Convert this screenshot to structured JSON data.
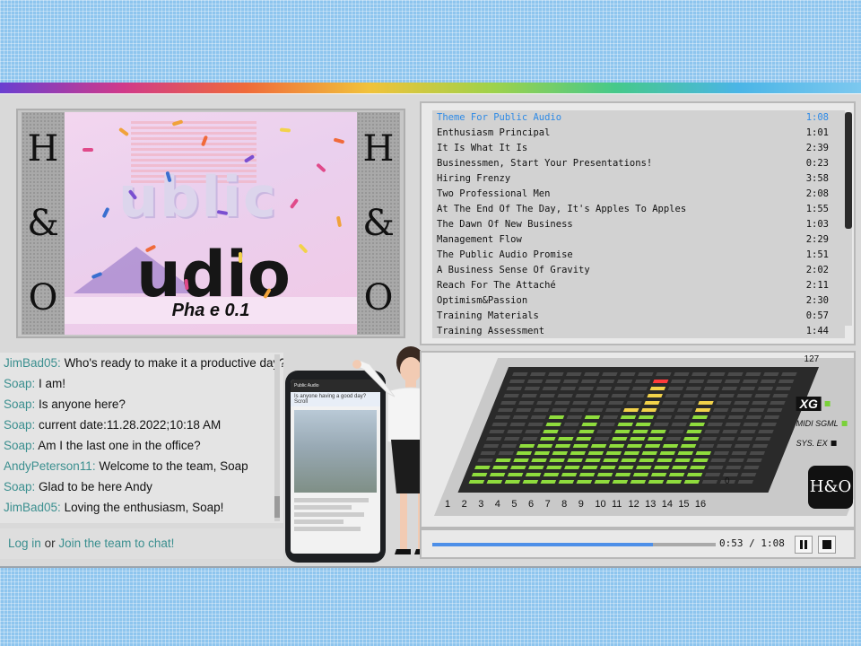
{
  "video": {
    "side_letters": [
      "H",
      "&",
      "O"
    ],
    "title_line1": "ublic",
    "title_line2": "udio",
    "subtitle": "Pha  e 0.1"
  },
  "playlist": [
    {
      "title": "Theme For Public Audio",
      "duration": "1:08",
      "active": true
    },
    {
      "title": "Enthusiasm Principal",
      "duration": "1:01"
    },
    {
      "title": "It Is What It Is",
      "duration": "2:39"
    },
    {
      "title": "Businessmen, Start Your Presentations!",
      "duration": "0:23"
    },
    {
      "title": "Hiring Frenzy",
      "duration": "3:58"
    },
    {
      "title": "Two Professional Men",
      "duration": "2:08"
    },
    {
      "title": "At The End Of The Day, It's Apples To Apples",
      "duration": "1:55"
    },
    {
      "title": "The Dawn Of New Business",
      "duration": "1:03"
    },
    {
      "title": "Management Flow",
      "duration": "2:29"
    },
    {
      "title": "The Public Audio Promise",
      "duration": "1:51"
    },
    {
      "title": "A Business Sense Of Gravity",
      "duration": "2:02"
    },
    {
      "title": "Reach For The Attaché",
      "duration": "2:11"
    },
    {
      "title": "Optimism&Passion",
      "duration": "2:30"
    },
    {
      "title": "Training Materials",
      "duration": "0:57"
    },
    {
      "title": "Training Assessment",
      "duration": "1:44"
    }
  ],
  "chat": {
    "messages": [
      {
        "user": "JimBad05",
        "text": "Who's ready to make it a productive day?"
      },
      {
        "user": "Soap",
        "text": "I am!"
      },
      {
        "user": "Soap",
        "text": "Is anyone here?"
      },
      {
        "user": "Soap",
        "text": "current date:11.28.2022;10:18 AM"
      },
      {
        "user": "Soap",
        "text": "Am I the last one in the office?"
      },
      {
        "user": "AndyPeterson11",
        "text": "Welcome to the team, Soap"
      },
      {
        "user": "Soap",
        "text": "Glad to be here Andy"
      },
      {
        "user": "JimBad05",
        "text": "Loving the enthusiasm, Soap!"
      }
    ],
    "login_label": "Log in",
    "or_label": "or",
    "join_label": "Join the team to chat!"
  },
  "phone": {
    "tab_label": "Public Audio",
    "question": "Is anyone having a good day? Scroll"
  },
  "equalizer": {
    "max_label": "127",
    "min_label": "0",
    "channels": [
      "1",
      "2",
      "3",
      "4",
      "5",
      "6",
      "7",
      "8",
      "9",
      "10",
      "11",
      "12",
      "13",
      "14",
      "15",
      "16"
    ],
    "levels": [
      0.18,
      0.28,
      0.4,
      0.6,
      0.45,
      0.6,
      0.4,
      0.68,
      0.93,
      0.48,
      0.35,
      0.75,
      0.3,
      0.0,
      0.0,
      0.0
    ],
    "status": [
      {
        "label": "XG",
        "led": "#7ad13a"
      },
      {
        "label": "MIDI SGML",
        "led": "#7ad13a"
      },
      {
        "label": "SYS. EX",
        "led": "#111111"
      }
    ]
  },
  "logo": {
    "text": "H&O"
  },
  "player": {
    "current": "0:53",
    "separator": "/",
    "total": "1:08",
    "progress": 0.78
  },
  "colors": {
    "accent": "#2e8ae6",
    "chat_user": "#3b8f8f",
    "eq_green": "#8fdc3d",
    "eq_yellow": "#f2d24a",
    "eq_red": "#ff3b3b"
  }
}
